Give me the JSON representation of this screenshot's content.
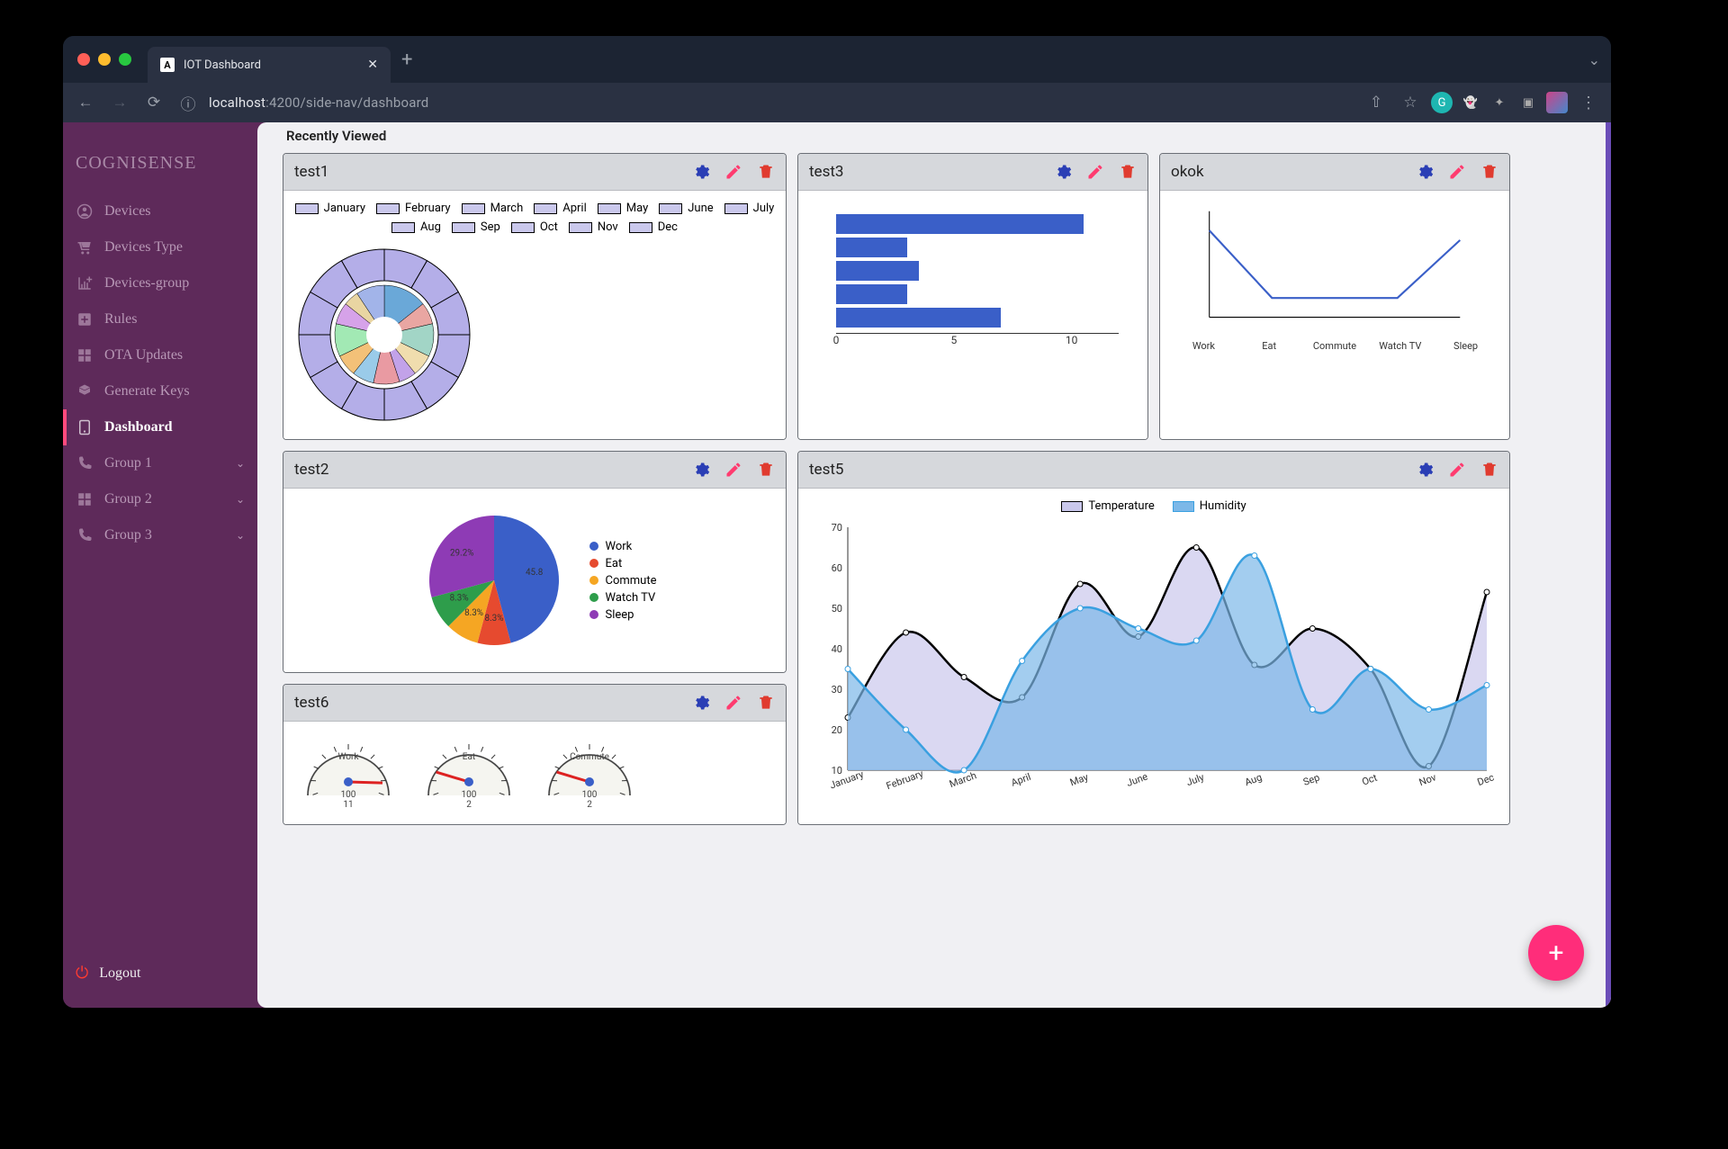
{
  "browser": {
    "tab_title": "IOT Dashboard",
    "tab_favicon_letter": "A",
    "url_host": "localhost",
    "url_port": ":4200",
    "url_path": "/side-nav/dashboard"
  },
  "sidebar": {
    "brand": "COGNISENSE",
    "items": [
      {
        "icon": "user-circle",
        "label": "Devices"
      },
      {
        "icon": "cart",
        "label": "Devices Type"
      },
      {
        "icon": "chart-add",
        "label": "Devices-group"
      },
      {
        "icon": "plus-box",
        "label": "Rules"
      },
      {
        "icon": "grid",
        "label": "OTA Updates"
      },
      {
        "icon": "key",
        "label": "Generate Keys"
      },
      {
        "icon": "dashboard",
        "label": "Dashboard",
        "active": true
      },
      {
        "icon": "phone",
        "label": "Group 1",
        "expandable": true
      },
      {
        "icon": "grid",
        "label": "Group 2",
        "expandable": true
      },
      {
        "icon": "phone",
        "label": "Group 3",
        "expandable": true
      }
    ],
    "logout": "Logout"
  },
  "main": {
    "section_title": "Recently Viewed",
    "fab_label": "+"
  },
  "cards": [
    {
      "id": "test1",
      "title": "test1"
    },
    {
      "id": "test3",
      "title": "test3"
    },
    {
      "id": "okok",
      "title": "okok"
    },
    {
      "id": "test2",
      "title": "test2"
    },
    {
      "id": "test5",
      "title": "test5"
    },
    {
      "id": "test6",
      "title": "test6"
    }
  ],
  "chart_data": [
    {
      "id": "test1",
      "type": "pie",
      "title": "",
      "note": "nested donut, outer ring = months",
      "categories": [
        "January",
        "February",
        "March",
        "April",
        "May",
        "June",
        "July",
        "Aug",
        "Sep",
        "Oct",
        "Nov",
        "Dec"
      ],
      "values": [
        1,
        1,
        1,
        1,
        1,
        1,
        1,
        1,
        1,
        1,
        1,
        1
      ],
      "inner_values": [
        2,
        1,
        1.5,
        1,
        0.8,
        1.2,
        1,
        1,
        1.5,
        1,
        0.7,
        1.3
      ],
      "outer_color": "#b4aee8",
      "inner_colors": [
        "#6aa8d8",
        "#e9a6a2",
        "#a2d5c6",
        "#f0ddae",
        "#c2a2e9",
        "#e99aa2",
        "#9acbe9",
        "#f3c178",
        "#a2e9b4",
        "#d6a2e9",
        "#e9d5a2",
        "#a2b4e9"
      ]
    },
    {
      "id": "test3",
      "type": "bar",
      "orientation": "horizontal",
      "categories": [
        "",
        "",
        "",
        "",
        ""
      ],
      "values": [
        10.5,
        3,
        3.5,
        3,
        7
      ],
      "xlim": [
        0,
        12
      ],
      "xticks": [
        0,
        5,
        10
      ],
      "color": "#3a5fc8"
    },
    {
      "id": "okok",
      "type": "line",
      "categories": [
        "Work",
        "Eat",
        "Commute",
        "Watch TV",
        "Sleep"
      ],
      "x": [
        0,
        1,
        2,
        3,
        4
      ],
      "values": [
        9,
        2,
        2,
        2,
        8
      ],
      "ylim": [
        0,
        10
      ],
      "color": "#3a5fc8"
    },
    {
      "id": "test2",
      "type": "pie",
      "series": [
        {
          "name": "Work",
          "value": 45.8,
          "label": "45.8",
          "color": "#3a5fc8"
        },
        {
          "name": "Eat",
          "value": 8.3,
          "label": "8.3%",
          "color": "#e64a2f"
        },
        {
          "name": "Commute",
          "value": 8.3,
          "label": "8.3%",
          "color": "#f5a623"
        },
        {
          "name": "Watch TV",
          "value": 8.3,
          "label": "8.3%",
          "color": "#2e9d4b"
        },
        {
          "name": "Sleep",
          "value": 29.2,
          "label": "29.2%",
          "color": "#8e3bb5"
        }
      ]
    },
    {
      "id": "test5",
      "type": "area",
      "x": [
        "January",
        "February",
        "March",
        "April",
        "May",
        "June",
        "July",
        "Aug",
        "Sep",
        "Oct",
        "Nov",
        "Dec"
      ],
      "series": [
        {
          "name": "Temperature",
          "color_fill": "#cac8ec",
          "color_stroke": "#000000",
          "values": [
            23,
            44,
            33,
            28,
            56,
            43,
            65,
            36,
            45,
            35,
            11,
            54
          ]
        },
        {
          "name": "Humidity",
          "color_fill": "#7cb8e8",
          "color_stroke": "#3aa0e0",
          "values": [
            35,
            20,
            10,
            37,
            50,
            45,
            42,
            63,
            25,
            35,
            25,
            31
          ]
        }
      ],
      "ylim": [
        10,
        70
      ],
      "yticks": [
        10,
        20,
        30,
        40,
        50,
        60,
        70
      ]
    },
    {
      "id": "test6",
      "type": "gauge",
      "gauges": [
        {
          "name": "Work",
          "value": 11,
          "max": 12
        },
        {
          "name": "Eat",
          "value": 2,
          "max": 12
        },
        {
          "name": "Commute",
          "value": 2,
          "max": 12
        }
      ],
      "label_prefix": "100"
    }
  ]
}
